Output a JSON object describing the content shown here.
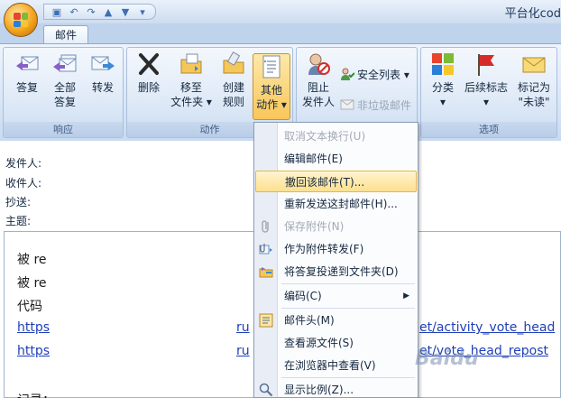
{
  "window": {
    "title": "平台化cod"
  },
  "quick_access": {
    "icons": [
      "save-icon",
      "undo-icon",
      "redo-icon",
      "up-arrow-icon",
      "down-arrow-icon",
      "dropdown-icon"
    ]
  },
  "tabs": [
    {
      "label": "邮件"
    }
  ],
  "ribbon": {
    "groups": {
      "respond": {
        "label": "响应",
        "buttons": [
          "答复",
          "全部\n答复",
          "转发"
        ]
      },
      "actions": {
        "label": "动作",
        "buttons": [
          "删除",
          "移至\n文件夹 ▾",
          "创建\n规则",
          "其他\n动作 ▾"
        ]
      },
      "junk": {
        "block_sender": "阻止\n发件人",
        "safe_list": "安全列表 ▾",
        "not_junk": "非垃圾邮件"
      },
      "options": {
        "label": "选项",
        "buttons": [
          "分类\n▾",
          "后续标志\n▾",
          "标记为\n\"未读\""
        ]
      }
    }
  },
  "header_fields": {
    "from": "发件人:",
    "to": "收件人:",
    "cc": "抄送:",
    "subject": "主题:"
  },
  "body": {
    "lines": [
      "被 re",
      "被 re",
      "代码",
      "https",
      "https",
      "记录："
    ],
    "link_tails": [
      "et/activity_vote_head",
      "et/vote_head_repost"
    ],
    "mid_fragments": [
      "ru",
      "ru"
    ]
  },
  "context_menu": {
    "items": [
      {
        "label": "取消文本换行(U)",
        "disabled": true,
        "icon": ""
      },
      {
        "label": "编辑邮件(E)",
        "disabled": false,
        "icon": ""
      },
      {
        "label": "撤回该邮件(T)...",
        "disabled": false,
        "highlighted": true,
        "icon": ""
      },
      {
        "label": "重新发送这封邮件(H)...",
        "disabled": false,
        "icon": ""
      },
      {
        "label": "保存附件(N)",
        "disabled": true,
        "icon": "paperclip-icon"
      },
      {
        "label": "作为附件转发(F)",
        "disabled": false,
        "icon": "attach-forward-icon"
      },
      {
        "label": "将答复投递到文件夹(D)",
        "disabled": false,
        "icon": "folder-deliver-icon"
      },
      {
        "label": "编码(C)",
        "disabled": false,
        "submenu": true,
        "icon": ""
      },
      {
        "label": "邮件头(M)",
        "disabled": false,
        "icon": "mail-header-icon"
      },
      {
        "label": "查看源文件(S)",
        "disabled": false,
        "icon": ""
      },
      {
        "label": "在浏览器中查看(V)",
        "disabled": false,
        "icon": ""
      },
      {
        "label": "显示比例(Z)...",
        "disabled": false,
        "icon": "zoom-icon"
      }
    ]
  },
  "watermark": {
    "text": "Baidu"
  }
}
